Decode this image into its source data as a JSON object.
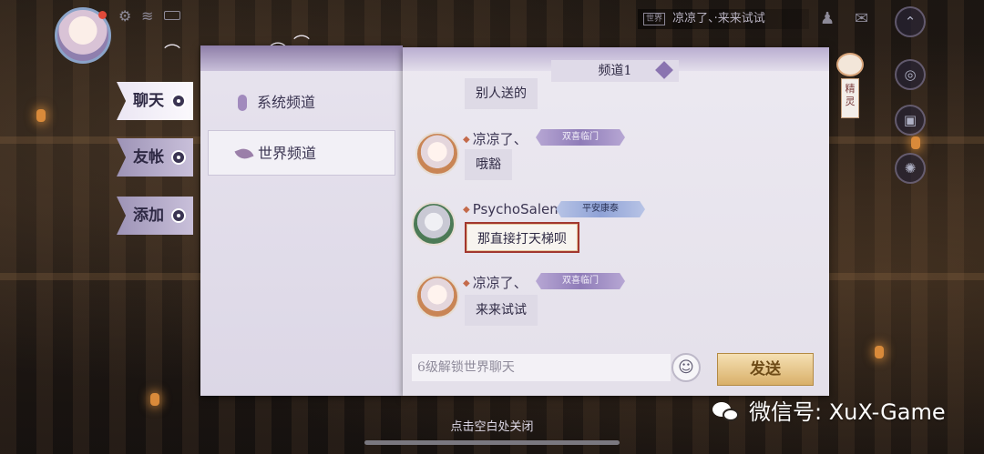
{
  "hud": {
    "ticker_tag": "世界",
    "ticker_text": "凉凉了、·来来试试"
  },
  "side_tabs": [
    {
      "label": "聊天",
      "active": true
    },
    {
      "label": "友帐",
      "active": false
    },
    {
      "label": "添加",
      "active": false
    }
  ],
  "channels": [
    {
      "label": "系统频道",
      "icon": "mic-icon",
      "active": false
    },
    {
      "label": "世界频道",
      "icon": "leaf-icon",
      "active": true
    }
  ],
  "chat": {
    "channel_title": "频道1",
    "messages": [
      {
        "sender": "",
        "badge": "",
        "text": "别人送的"
      },
      {
        "sender": "凉凉了、",
        "badge": "双喜临门",
        "text": "哦豁"
      },
      {
        "sender": "PsychoSalem",
        "badge": "平安康泰",
        "text": "那直接打天梯呗"
      },
      {
        "sender": "凉凉了、",
        "badge": "双喜临门",
        "text": "来来试试"
      }
    ],
    "input_placeholder": "6级解锁世界聊天",
    "send_label": "发送",
    "close_hint": "点击空白处关闭"
  },
  "spirit": {
    "label": "精灵"
  },
  "watermark": {
    "text": "微信号: XuX-Game"
  },
  "colors": {
    "panel_bg": "#ece9f1",
    "accent_purple": "#8f7cb8",
    "send_gold": "#d9b06a",
    "highlight_frame": "#a2372f"
  }
}
